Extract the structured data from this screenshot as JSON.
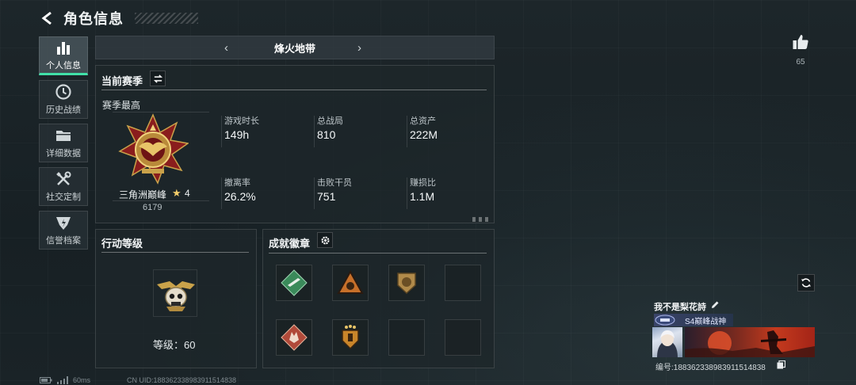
{
  "header": {
    "title": "角色信息"
  },
  "sidenav": {
    "items": [
      {
        "label": "个人信息",
        "icon": "bar-chart-icon",
        "active": true
      },
      {
        "label": "历史战绩",
        "icon": "clock-icon",
        "active": false
      },
      {
        "label": "详细数据",
        "icon": "folder-icon",
        "active": false
      },
      {
        "label": "社交定制",
        "icon": "tools-icon",
        "active": false
      },
      {
        "label": "信誉档案",
        "icon": "shield-icon",
        "active": false
      }
    ]
  },
  "mode_selector": {
    "current": "烽火地带",
    "prev_icon": "chevron-left-icon",
    "next_icon": "chevron-right-icon"
  },
  "season_panel": {
    "title": "当前赛季",
    "switch_icon": "swap-icon",
    "peak_label": "赛季最高",
    "rank": {
      "name": "三角洲巅峰",
      "stars": "4",
      "score": "6179",
      "emblem": "peak-rank-emblem",
      "accent": "#c9a24a"
    },
    "stats": [
      {
        "label": "游戏时长",
        "value": "149h"
      },
      {
        "label": "总战局",
        "value": "810"
      },
      {
        "label": "总资产",
        "value": "222M"
      },
      {
        "label": "撤离率",
        "value": "26.2%"
      },
      {
        "label": "击败干员",
        "value": "751"
      },
      {
        "label": "赚损比",
        "value": "1.1M"
      }
    ]
  },
  "level_panel": {
    "title": "行动等级",
    "level_text": "等级：60",
    "emblem": "skull-wings-emblem"
  },
  "achievement_panel": {
    "title": "成就徽章",
    "settings_icon": "gear-icon",
    "badges": [
      {
        "icon": "badge-green-rifle-icon",
        "color": "#3a8a5a"
      },
      {
        "icon": "badge-orange-triangle-icon",
        "color": "#c7702a"
      },
      {
        "icon": "badge-bronze-lion-icon",
        "color": "#b08a4a"
      },
      {
        "icon": "empty-slot",
        "color": ""
      },
      {
        "icon": "badge-red-wolf-icon",
        "color": "#b04a3a"
      },
      {
        "icon": "badge-stars-shield-icon",
        "color": "#c9852a"
      },
      {
        "icon": "empty-slot",
        "color": ""
      },
      {
        "icon": "empty-slot",
        "color": ""
      }
    ]
  },
  "like": {
    "icon": "thumbs-up-icon",
    "count": "65"
  },
  "profile": {
    "name": "我不是梨花詩",
    "title_badge": "S4巅峰战神",
    "id_text": "编号:1883623389839115148​38",
    "refresh_icon": "refresh-icon",
    "edit_icon": "pencil-icon",
    "copy_icon": "copy-icon"
  },
  "status": {
    "ping": "60ms",
    "uid": "CN UID:1883623389839115148​38"
  },
  "colors": {
    "accent": "#41e0a8",
    "gold": "#f2cd6a"
  }
}
